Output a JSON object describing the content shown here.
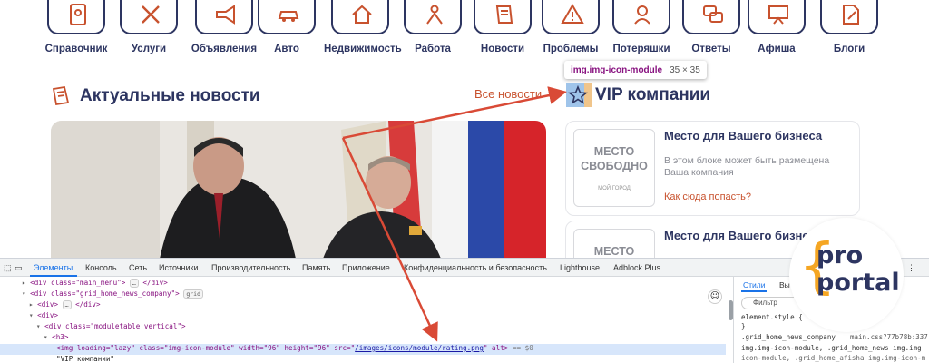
{
  "nav": {
    "categories": [
      {
        "label": "Справочник",
        "icon": "directory-book-icon"
      },
      {
        "label": "Услуги",
        "icon": "tools-icon"
      },
      {
        "label": "Объявления",
        "icon": "megaphone-icon"
      },
      {
        "label": "Авто",
        "icon": "car-icon"
      },
      {
        "label": "Недвижимость",
        "icon": "house-icon"
      },
      {
        "label": "Работа",
        "icon": "worker-icon"
      },
      {
        "label": "Новости",
        "icon": "newspaper-icon"
      },
      {
        "label": "Проблемы",
        "icon": "warning-icon"
      },
      {
        "label": "Потеряшки",
        "icon": "person-search-icon"
      },
      {
        "label": "Ответы",
        "icon": "chat-bubbles-icon"
      },
      {
        "label": "Афиша",
        "icon": "presentation-board-icon"
      },
      {
        "label": "Блоги",
        "icon": "blog-pen-icon"
      }
    ]
  },
  "news": {
    "title": "Актуальные новости",
    "all_link": "Все новости"
  },
  "tooltip": {
    "selector": "img.img-icon-module",
    "size": "35 × 35"
  },
  "vip": {
    "title": "VIP компании",
    "cards": [
      {
        "placeholder_line1": "МЕСТО",
        "placeholder_line2": "СВОБОДНО",
        "placeholder_brand": "МОЙ ГОРОД",
        "title": "Место для Вашего бизнеса",
        "desc": "В этом блоке может быть размещена Ваша компания",
        "link": "Как сюда попасть?"
      },
      {
        "placeholder_line1": "МЕСТО",
        "title": "Место для Вашего бизнеса"
      }
    ]
  },
  "devtools": {
    "tabs": [
      "Элементы",
      "Консоль",
      "Сеть",
      "Источники",
      "Производительность",
      "Память",
      "Приложение",
      "Конфиденциальность и безопасность",
      "Lighthouse",
      "Adblock Plus"
    ],
    "side_tabs": [
      "Стили",
      "Вы"
    ],
    "filter_placeholder": "Фильтр",
    "dom": {
      "l1_open": "<div class=\"main_menu\">",
      "l1_ellipsis": "…",
      "l1_close": "</div>",
      "l2_open": "<div class=\"grid_home_news_company\">",
      "l2_chip": "grid",
      "l3_open": "<div>",
      "l3_ellipsis": "…",
      "l3_close": "</div>",
      "l4": "<div>",
      "l5": "<div class=\"moduletable vertical\">",
      "l6": "<h3>",
      "l7_a": "<img loading=\"lazy\" class=\"img-icon-module\" width=\"96\" height=\"96\" src=\"",
      "l7_src": "/images/icons/module/rating.png",
      "l7_b": "\" alt>",
      "l7_eq": "== $0",
      "l8": "\"VIP компании\""
    },
    "styles": {
      "element_style": "element.style {",
      "close_brace": "}",
      "rule1": ".grid_home_news_company",
      "file": "main.css?77b78b:337",
      "rule2": "img.img-icon-module, .grid_home_news img.img",
      "rule3": "icon-module, .grid_home_afisha img.img-icon-m"
    }
  },
  "logo": {
    "line1": "pro",
    "line2": "portal",
    "brace": "{"
  },
  "colors": {
    "navy": "#2d3561",
    "accent": "#c8522e",
    "logo_orange": "#f5a623",
    "devtools_blue": "#1a73e8"
  }
}
